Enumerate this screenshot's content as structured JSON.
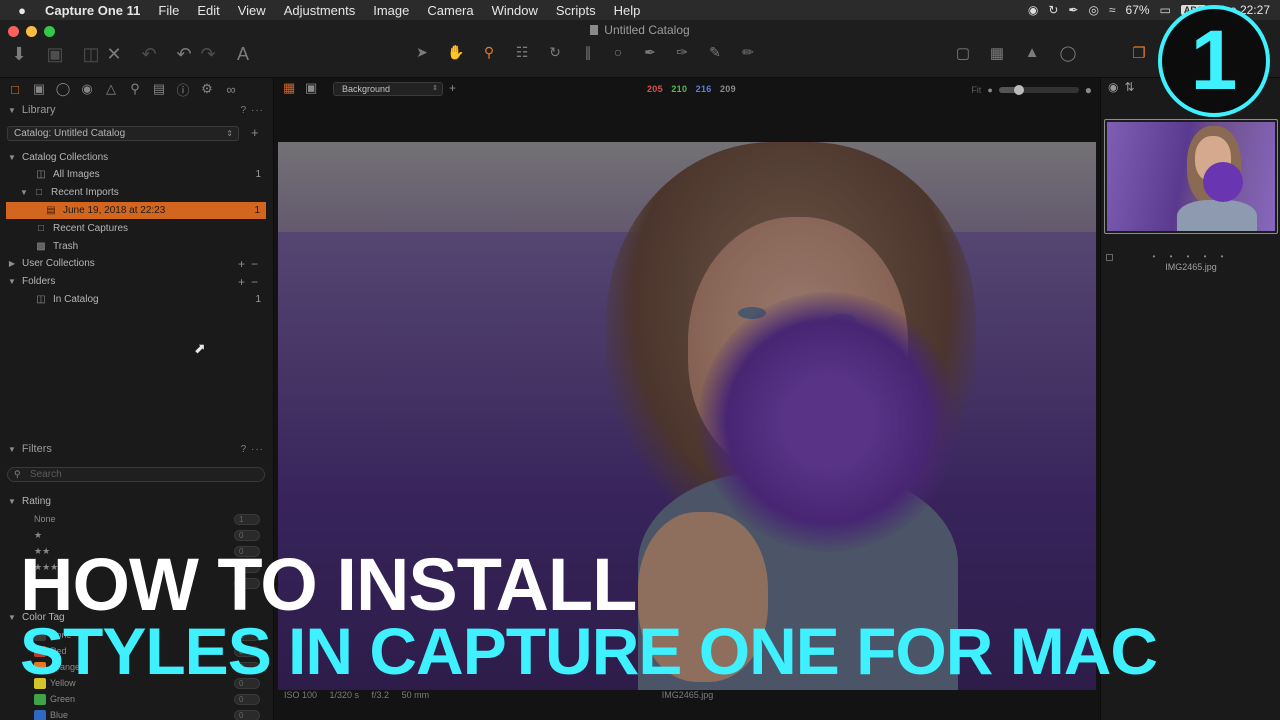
{
  "menubar": {
    "apple": "",
    "items": [
      "Capture One 11",
      "File",
      "Edit",
      "View",
      "Adjustments",
      "Image",
      "Camera",
      "Window",
      "Scripts",
      "Help"
    ],
    "battery": "67%",
    "input_source": "ABC",
    "clock": "Tue 22:27"
  },
  "window": {
    "title": "Untitled Catalog",
    "traffic_colors": [
      "#fc605c",
      "#fdbc40",
      "#34c84a"
    ]
  },
  "library": {
    "header": "Library",
    "header_tail": "? ···",
    "catalog_select": "Catalog: Untitled Catalog",
    "catalog_collections_header": "Catalog Collections",
    "items": [
      {
        "label": "All Images",
        "count": "1"
      },
      {
        "label": "Recent Imports",
        "count": ""
      },
      {
        "label": "June 19, 2018 at 22:23",
        "count": "1"
      },
      {
        "label": "Recent Captures",
        "count": ""
      },
      {
        "label": "Trash",
        "count": ""
      }
    ],
    "user_collections": "User Collections",
    "folders": "Folders",
    "in_catalog": "In Catalog",
    "in_catalog_count": "1"
  },
  "filters": {
    "header": "Filters",
    "header_tail": "? ···",
    "search_placeholder": "Search",
    "rating_header": "Rating",
    "ratings": [
      {
        "label": "None",
        "count": "1"
      },
      {
        "label": "★",
        "count": "0"
      },
      {
        "label": "★★",
        "count": "0"
      },
      {
        "label": "★★★",
        "count": "0"
      },
      {
        "label": "★★★★",
        "count": "0"
      }
    ],
    "color_tag_header": "Color Tag",
    "colors": [
      {
        "label": "None",
        "count": "1",
        "color": "#3a3a3a"
      },
      {
        "label": "Red",
        "count": "0",
        "color": "#c0392b"
      },
      {
        "label": "Orange",
        "count": "0",
        "color": "#e07a27"
      },
      {
        "label": "Yellow",
        "count": "0",
        "color": "#d4c32a"
      },
      {
        "label": "Green",
        "count": "0",
        "color": "#3fa34a"
      },
      {
        "label": "Blue",
        "count": "0",
        "color": "#2f69c4"
      }
    ]
  },
  "viewer": {
    "background_select": "Background",
    "rgb": {
      "r": "205",
      "g": "210",
      "b": "216",
      "a": "209"
    },
    "rgb_colors": {
      "r": "#d95050",
      "g": "#56b856",
      "b": "#5b7fe0",
      "a": "#8a8a8a"
    },
    "fit_label": "Fit",
    "zoom_level": 0.25,
    "exif": "ISO 100     1/320 s     f/3.2     50 mm",
    "filename": "IMG2465.jpg"
  },
  "browser": {
    "thumb_name": "IMG2465.jpg",
    "stars": "• • • • •"
  },
  "overlay": {
    "line1": "HOW TO INSTALL",
    "line2": "STYLES IN CAPTURE ONE FOR MAC",
    "badge": "1",
    "accent": "#3ff0ff"
  }
}
